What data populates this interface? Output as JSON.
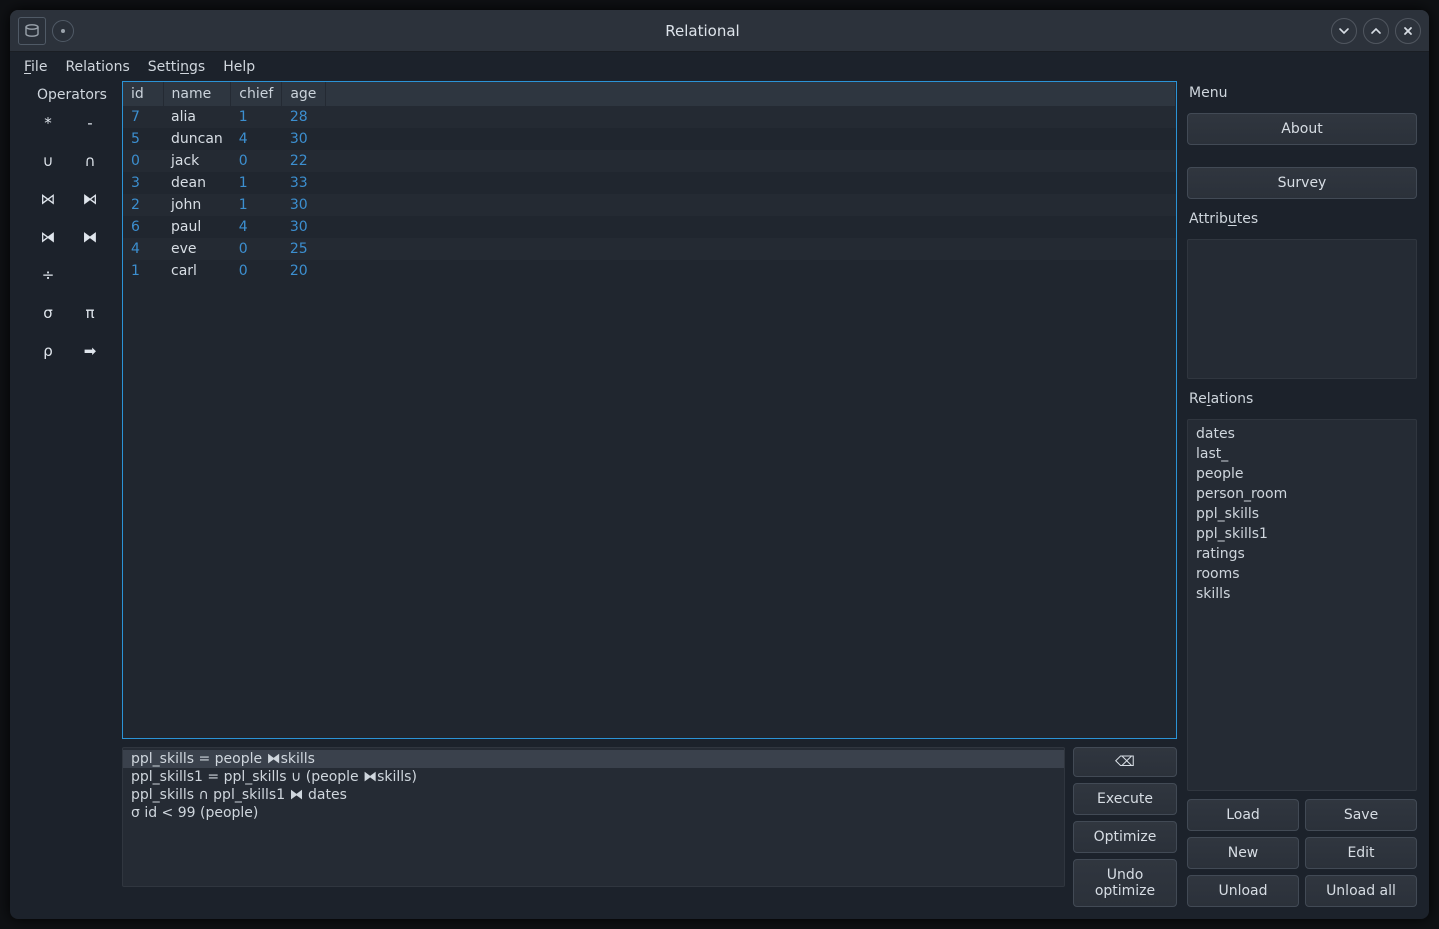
{
  "title": "Relational",
  "menubar": {
    "file": "File",
    "relations": "Relations",
    "settings": "Settings",
    "help": "Help"
  },
  "operators_title": "Operators",
  "operators": [
    "*",
    "-",
    "∪",
    "∩",
    "⋈",
    "⧑",
    "⧒",
    "⧓",
    "÷",
    "",
    "σ",
    "π",
    "ρ",
    "➡"
  ],
  "table": {
    "headers": [
      "id",
      "name",
      "chief",
      "age"
    ],
    "rows": [
      {
        "id": "7",
        "name": "alia",
        "chief": "1",
        "age": "28"
      },
      {
        "id": "5",
        "name": "duncan",
        "chief": "4",
        "age": "30"
      },
      {
        "id": "0",
        "name": "jack",
        "chief": "0",
        "age": "22"
      },
      {
        "id": "3",
        "name": "dean",
        "chief": "1",
        "age": "33"
      },
      {
        "id": "2",
        "name": "john",
        "chief": "1",
        "age": "30"
      },
      {
        "id": "6",
        "name": "paul",
        "chief": "4",
        "age": "30"
      },
      {
        "id": "4",
        "name": "eve",
        "chief": "0",
        "age": "25"
      },
      {
        "id": "1",
        "name": "carl",
        "chief": "0",
        "age": "20"
      }
    ]
  },
  "history": [
    "ppl_skills = people ⧓skills",
    "ppl_skills1 = ppl_skills ∪ (people ⧓skills)",
    "ppl_skills ∩ ppl_skills1 ⧓ dates",
    "σ id < 99 (people)"
  ],
  "history_selected": 0,
  "query_buttons": {
    "clear": "⌫",
    "execute": "Execute",
    "optimize": "Optimize",
    "undo": "Undo optimize"
  },
  "right": {
    "menu_title": "Menu",
    "about": "About",
    "survey": "Survey",
    "attributes_title": "Attributes",
    "relations_title": "Relations",
    "relations": [
      "dates",
      "last_",
      "people",
      "person_room",
      "ppl_skills",
      "ppl_skills1",
      "ratings",
      "rooms",
      "skills"
    ],
    "buttons": {
      "load": "Load",
      "save": "Save",
      "new": "New",
      "edit": "Edit",
      "unload": "Unload",
      "unload_all": "Unload all"
    }
  }
}
